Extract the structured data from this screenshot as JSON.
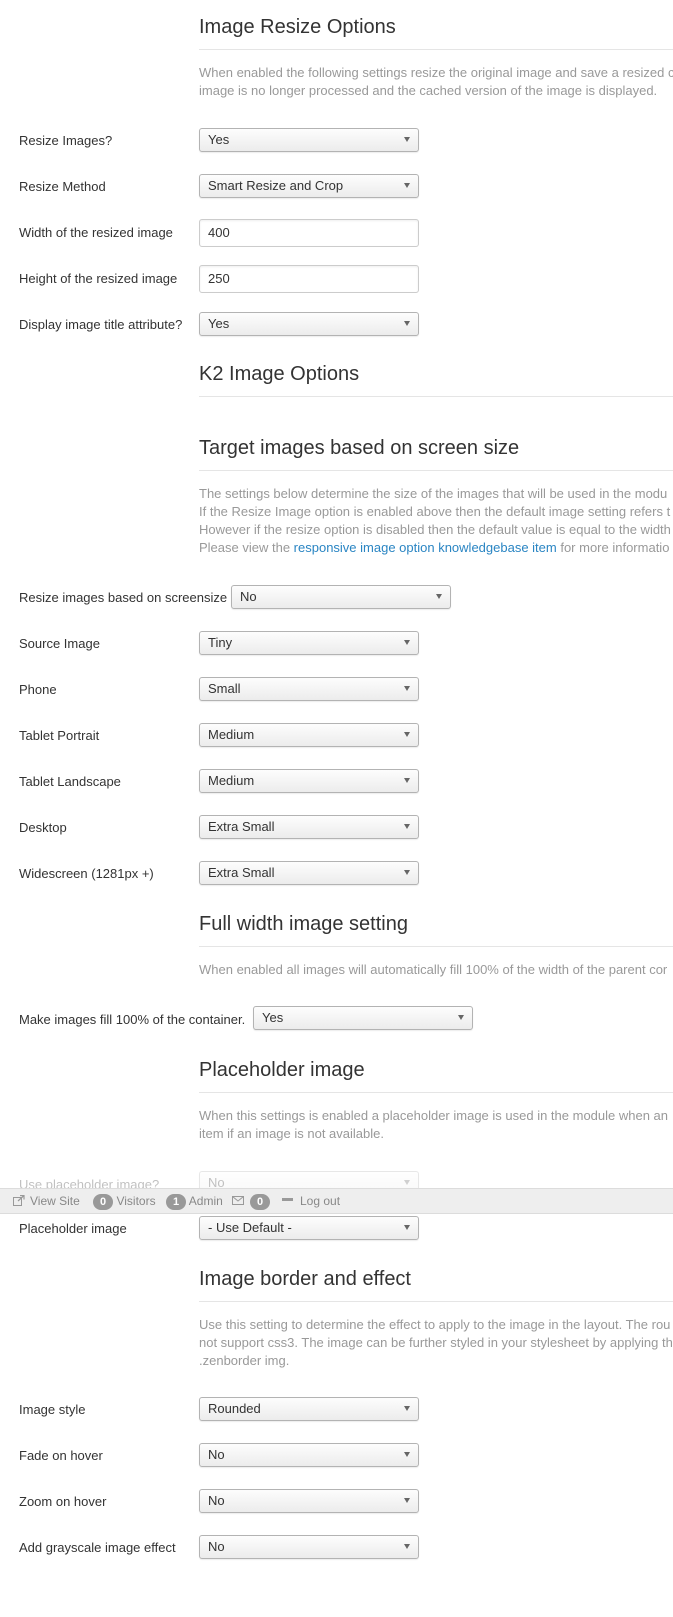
{
  "sections": {
    "resize": {
      "title": "Image Resize Options",
      "desc_line1": "When enabled the following settings resize the original image and save a resized c",
      "desc_line2": "image is no longer processed and the cached version of the image is displayed."
    },
    "k2": {
      "title": "K2 Image Options"
    },
    "screen": {
      "title": "Target images based on screen size",
      "desc_line1": "The settings below determine the size of the images that will be used in the modu",
      "desc_line2": "If the Resize Image option is enabled above then the default image setting refers t",
      "desc_line3": "However if the resize option is disabled then the default value is equal to the width",
      "desc_pre": "Please view the ",
      "desc_link": "responsive image option knowledgebase item",
      "desc_post": " for more informatio"
    },
    "fullwidth": {
      "title": "Full width image setting",
      "desc_line1": "When enabled all images will automatically fill 100% of the width of the parent cor"
    },
    "placeholder": {
      "title": "Placeholder image",
      "desc_line1": "When this settings is enabled a placeholder image is used in the module when an",
      "desc_line2": "item if an image is not available."
    },
    "border": {
      "title": "Image border and effect",
      "desc_line1": "Use this setting to determine the effect to apply to the image in the layout. The rou",
      "desc_line2": "not support css3. The image can be further styled in your stylesheet by applying th",
      "desc_line3": ".zenborder img."
    }
  },
  "fields": {
    "resize_images": {
      "label": "Resize Images?",
      "value": "Yes"
    },
    "resize_method": {
      "label": "Resize Method",
      "value": "Smart Resize and Crop"
    },
    "width": {
      "label": "Width of the resized image",
      "value": "400"
    },
    "height": {
      "label": "Height of the resized image",
      "value": "250"
    },
    "display_title": {
      "label": "Display image title attribute?",
      "value": "Yes"
    },
    "resize_screensize": {
      "label": "Resize images based on screensize",
      "value": "No"
    },
    "source_image": {
      "label": "Source Image",
      "value": "Tiny"
    },
    "phone": {
      "label": "Phone",
      "value": "Small"
    },
    "tablet_portrait": {
      "label": "Tablet Portrait",
      "value": "Medium"
    },
    "tablet_landscape": {
      "label": "Tablet Landscape",
      "value": "Medium"
    },
    "desktop": {
      "label": "Desktop",
      "value": "Extra Small"
    },
    "widescreen": {
      "label": "Widescreen (1281px +)",
      "value": "Extra Small"
    },
    "fill_container": {
      "label": "Make images fill 100% of the container.",
      "value": "Yes"
    },
    "use_placeholder": {
      "label": "Use placeholder image?",
      "value": "No"
    },
    "placeholder_image": {
      "label": "Placeholder image",
      "value": "- Use Default -"
    },
    "image_style": {
      "label": "Image style",
      "value": "Rounded"
    },
    "fade_hover": {
      "label": "Fade on hover",
      "value": "No"
    },
    "zoom_hover": {
      "label": "Zoom on hover",
      "value": "No"
    },
    "grayscale": {
      "label": "Add grayscale image effect",
      "value": "No"
    }
  },
  "statusbar": {
    "view_site": "View Site",
    "visitors_count": "0",
    "visitors_label": "Visitors",
    "admin_count": "1",
    "admin_label": "Admin",
    "messages_count": "0",
    "logout": "Log out"
  }
}
